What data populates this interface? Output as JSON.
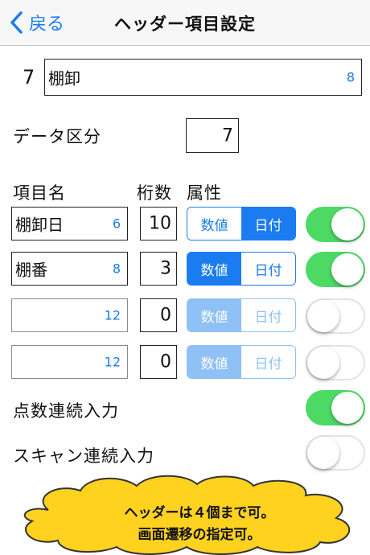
{
  "nav": {
    "back_label": "戻る",
    "title": "ヘッダー項目設定"
  },
  "header": {
    "number": "7",
    "name_value": "棚卸",
    "name_count": "8"
  },
  "data_kubun": {
    "label": "データ区分",
    "value": "7"
  },
  "columns": {
    "item_name": "項目名",
    "digits": "桁数",
    "attribute": "属性"
  },
  "rows": [
    {
      "name": "棚卸日",
      "count": "6",
      "digits": "10",
      "options": [
        "数値",
        "日付"
      ],
      "selected": "日付",
      "enabled": true,
      "toggle_on": true
    },
    {
      "name": "棚番",
      "count": "8",
      "digits": "3",
      "options": [
        "数値",
        "日付"
      ],
      "selected": "数値",
      "enabled": true,
      "toggle_on": true
    },
    {
      "name": "",
      "count": "12",
      "digits": "0",
      "options": [
        "数値",
        "日付"
      ],
      "selected": "数値",
      "enabled": false,
      "toggle_on": false
    },
    {
      "name": "",
      "count": "12",
      "digits": "0",
      "options": [
        "数値",
        "日付"
      ],
      "selected": "数値",
      "enabled": false,
      "toggle_on": false
    }
  ],
  "settings": [
    {
      "label": "点数連続入力",
      "on": true
    },
    {
      "label": "スキャン連続入力",
      "on": false
    }
  ],
  "callout": {
    "line1": "ヘッダーは４個まで可。",
    "line2": "画面遷移の指定可。"
  },
  "colors": {
    "accent": "#1a7cf0",
    "toggle_on": "#4cd964",
    "callout_fill": "#ffd21f"
  },
  "icons": {
    "back": "chevron-left-icon"
  }
}
